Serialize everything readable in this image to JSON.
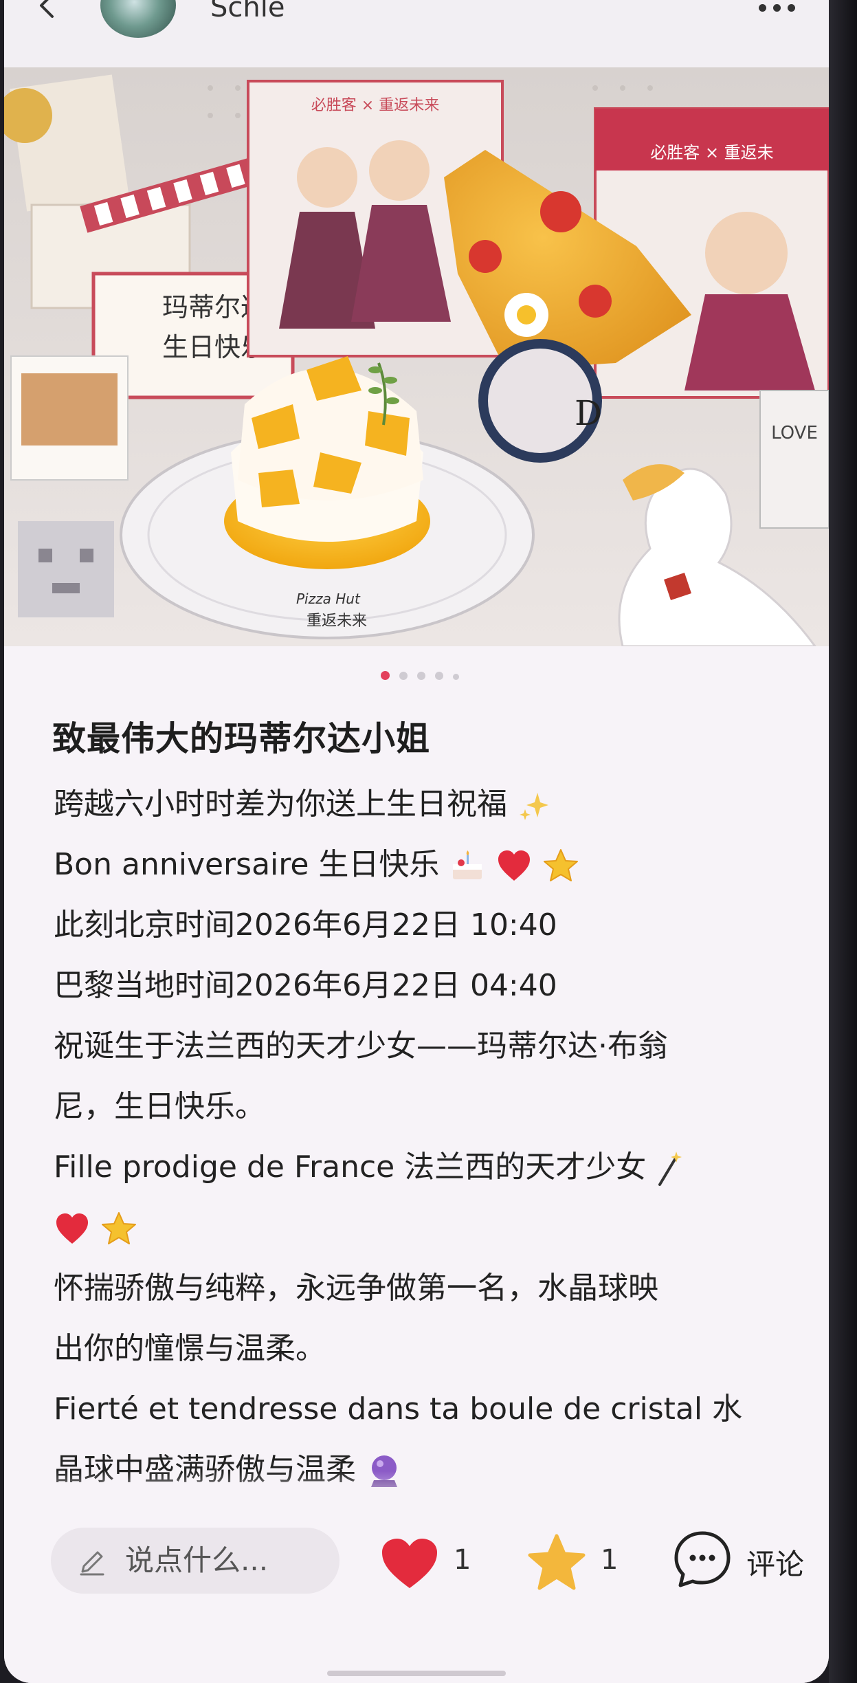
{
  "header": {
    "username": "Schle"
  },
  "carousel": {
    "page_count": 5,
    "active_index": 0,
    "photo_text": {
      "sign": "玛蒂尔达\n生日快乐~",
      "plate_brand": "Pizza Hut",
      "plate_sub": "重返未来",
      "card_brand": "必胜客 × 重返未来",
      "card_brand_2": "必胜客 × 重返未",
      "badge_letter": "D",
      "tag": "LOVE"
    }
  },
  "post": {
    "title": "致最伟大的玛蒂尔达小姐",
    "lines": [
      "跨越六小时时差为你送上生日祝福",
      "Bon anniversaire 生日快乐",
      "此刻北京时间2026年6月22日 10:40",
      "巴黎当地时间2026年6月22日 04:40",
      "祝诞生于法兰西的天才少女——玛蒂尔达·布翁",
      "尼，生日快乐。",
      "Fille prodige de France 法兰西的天才少女",
      "",
      "怀揣骄傲与纯粹，永远争做第一名，水晶球映",
      "出你的憧憬与温柔。",
      "Fierté et tendresse dans ta boule de cristal 水",
      "晶球中盛满骄傲与温柔"
    ],
    "emojis": {
      "line0": "sparkles",
      "line1": [
        "cake",
        "heart",
        "star"
      ],
      "line6": "magic-wand",
      "line7": [
        "heart",
        "star"
      ],
      "line11": "crystal-ball"
    }
  },
  "bottombar": {
    "comment_placeholder": "说点什么...",
    "likes": "1",
    "favorites": "1",
    "comment_label": "评论"
  },
  "colors": {
    "like": "#e32b3d",
    "star": "#f3b73c",
    "accent_dot": "#e3405c",
    "background": "#f7f3f8"
  }
}
